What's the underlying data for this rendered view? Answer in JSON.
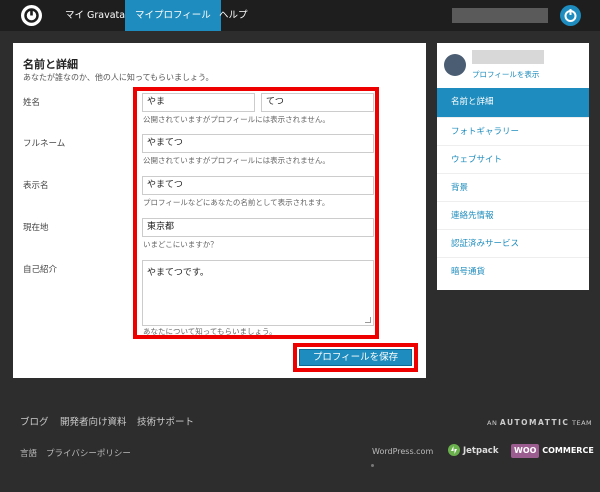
{
  "nav": {
    "items": [
      "マイ Gravatar",
      "マイプロフィール",
      "ヘルプ"
    ],
    "active": "マイプロフィール"
  },
  "section": {
    "title": "名前と詳細",
    "subtitle": "あなたが誰なのか、他の人に知ってもらいましょう。"
  },
  "form": {
    "name_label": "姓名",
    "last_name": "やま",
    "first_name": "てつ",
    "name_hint": "公開されていますがプロフィールには表示されません。",
    "full_name_label": "フルネーム",
    "full_name": "やまてつ",
    "full_name_hint": "公開されていますがプロフィールには表示されません。",
    "display_name_label": "表示名",
    "display_name": "やまてつ",
    "display_name_hint": "プロフィールなどにあなたの名前として表示されます。",
    "location_label": "現在地",
    "location": "東京都",
    "location_hint": "いまどこにいますか？",
    "bio_label": "自己紹介",
    "bio": "やまてつです。",
    "bio_hint": "あなたについて知ってもらいましょう。",
    "save_label": "プロフィールを保存"
  },
  "sidebar": {
    "profile_link": "プロフィールを表示",
    "items": [
      "名前と詳細",
      "フォトギャラリー",
      "ウェブサイト",
      "背景",
      "連絡先情報",
      "認証済みサービス",
      "暗号通貨"
    ],
    "active_index": 0
  },
  "footer": {
    "links": [
      "ブログ",
      "開発者向け資料",
      "技術サポート"
    ],
    "bottom_links": [
      "言語",
      "プライバシーポリシー"
    ],
    "automattic_prefix": "AN",
    "automattic": "AUTOMATTIC",
    "automattic_suffix": "TEAM",
    "wordpress": "WordPress.com",
    "jetpack": "Jetpack",
    "woo_badge": "WOO",
    "woo_text": "COMMERCE"
  },
  "colors": {
    "accent": "#1e8cbe",
    "highlight": "#e00000",
    "topbar": "#1e1e1e",
    "background": "#2d2d2d"
  }
}
